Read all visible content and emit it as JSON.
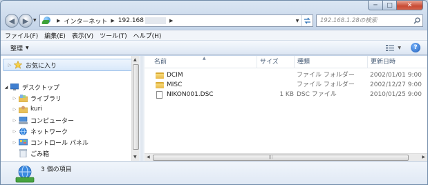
{
  "window": {
    "controls": {
      "minimize": "─",
      "maximize": "□",
      "close": "✕"
    }
  },
  "address_bar": {
    "crumbs": [
      "インターネット",
      "192.168"
    ],
    "search_placeholder": "192.168.1.28の検索"
  },
  "menu": [
    "ファイル(F)",
    "編集(E)",
    "表示(V)",
    "ツール(T)",
    "ヘルプ(H)"
  ],
  "command_bar": {
    "organize_label": "整理"
  },
  "nav_pane": {
    "favorites": "お気に入り",
    "desktop": "デスクトップ",
    "items": [
      "ライブラリ",
      "kuri",
      "コンピューター",
      "ネットワーク",
      "コントロール パネル",
      "ごみ箱"
    ]
  },
  "columns": {
    "name": "名前",
    "size": "サイズ",
    "type": "種類",
    "date": "更新日時"
  },
  "files": [
    {
      "name": "DCIM",
      "size": "",
      "type": "ファイル フォルダー",
      "date": "2002/01/01 9:00",
      "icon": "folder-icon"
    },
    {
      "name": "MISC",
      "size": "",
      "type": "ファイル フォルダー",
      "date": "2002/12/27 9:00",
      "icon": "folder-icon"
    },
    {
      "name": "NIKON001.DSC",
      "size": "1 KB",
      "type": "DSC ファイル",
      "date": "2010/01/25 9:00",
      "icon": "document-icon"
    }
  ],
  "details": {
    "item_count": "3 個の項目"
  },
  "colors": {
    "accent": "#2b6fb5",
    "folder": "#e8b94a",
    "window_frame": "#c5d5e9"
  }
}
